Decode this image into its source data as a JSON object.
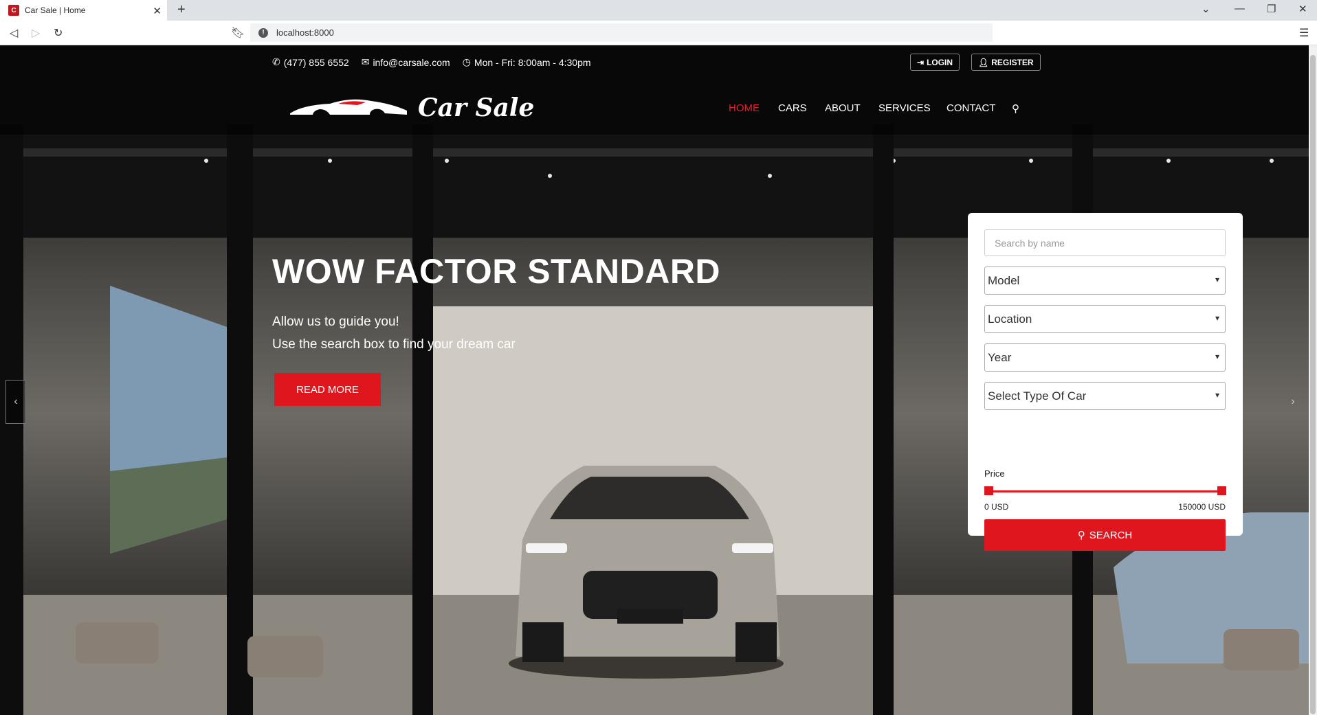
{
  "browser": {
    "tab_title": "Car Sale | Home",
    "favicon_letter": "C",
    "url": "localhost:8000"
  },
  "topbar": {
    "phone": "(477) 855 6552",
    "email": "info@carsale.com",
    "hours": "Mon - Fri: 8:00am - 4:30pm",
    "login_label": "LOGIN",
    "register_label": "REGISTER"
  },
  "brand": {
    "name": "Car Sale"
  },
  "nav": {
    "items": [
      {
        "label": "HOME",
        "active": true
      },
      {
        "label": "CARS"
      },
      {
        "label": "ABOUT"
      },
      {
        "label": "SERVICES"
      },
      {
        "label": "CONTACT"
      }
    ]
  },
  "hero": {
    "title": "WOW FACTOR STANDARD",
    "line1": "Allow us to guide you!",
    "line2": "Use the search box to find your dream car",
    "cta_label": "READ MORE"
  },
  "search": {
    "name_placeholder": "Search by name",
    "model": "Model",
    "location": "Location",
    "year": "Year",
    "type": "Select Type Of Car",
    "price_label": "Price",
    "price_min": "0 USD",
    "price_max": "150000 USD",
    "button_label": "SEARCH"
  },
  "colors": {
    "accent": "#e0161e"
  }
}
